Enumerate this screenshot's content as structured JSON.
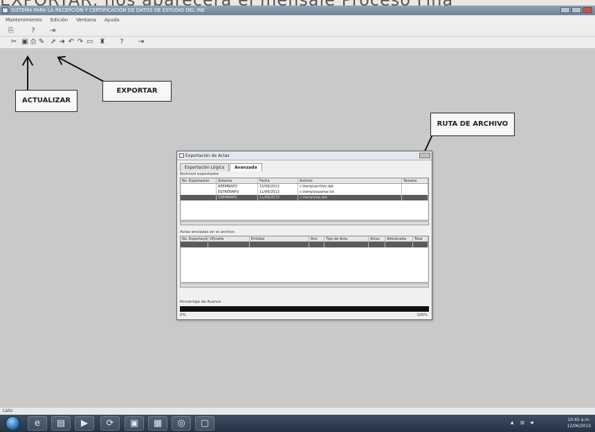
{
  "top_strip_text": "EXPORTAR, nos aparecerá el mensaje Proceso Fina",
  "window": {
    "title": "SISTEMA PARA LA RECEPCIÓN Y CERTIFICACIÓN DE DATOS DE ESTUDIO DEL INE"
  },
  "menu": {
    "items": [
      "Mantenimiento",
      "Edición",
      "Ventana",
      "Ayuda"
    ]
  },
  "callouts": {
    "actualizar": "ACTUALIZAR",
    "exportar": "EXPORTAR",
    "ruta": "RUTA DE ARCHIVO"
  },
  "dialog": {
    "title": "Exportación de Actas",
    "tabs": [
      "Exportación Lógica",
      "Avanzada"
    ],
    "group1_label": "Archivos exportados",
    "grid1": {
      "headers": [
        "No. Exportación",
        "Sistema",
        "Fecha",
        "Archivo",
        "Tamaño"
      ],
      "rows": [
        [
          "REEMBAPO",
          "15/06/2013",
          "c:\\temp\\archivo.dat",
          ""
        ],
        [
          "ESTRENAPO",
          "11/06/2013",
          "c:\\temp\\exportar.txt",
          ""
        ],
        [
          "SSEMBAPO",
          "11/06/2013",
          "c:\\temp\\exp.dat",
          ""
        ]
      ]
    },
    "group2_label": "Actas enviadas en el archivo",
    "grid2": {
      "headers": [
        "No. Exportación",
        "Oficialía",
        "Entidad",
        "Año",
        "Tipo de Acta",
        "Actas",
        "Adicionales",
        "Total"
      ],
      "rows": [
        [
          "",
          "",
          "",
          "",
          "",
          "",
          "",
          ""
        ]
      ]
    },
    "progress_label": "Porcentaje de Avance",
    "progress_left": "0%",
    "progress_right": "100%"
  },
  "status_text": "Listo",
  "taskbar": {
    "clock_time": "10:45 a.m.",
    "clock_date": "12/06/2013"
  }
}
